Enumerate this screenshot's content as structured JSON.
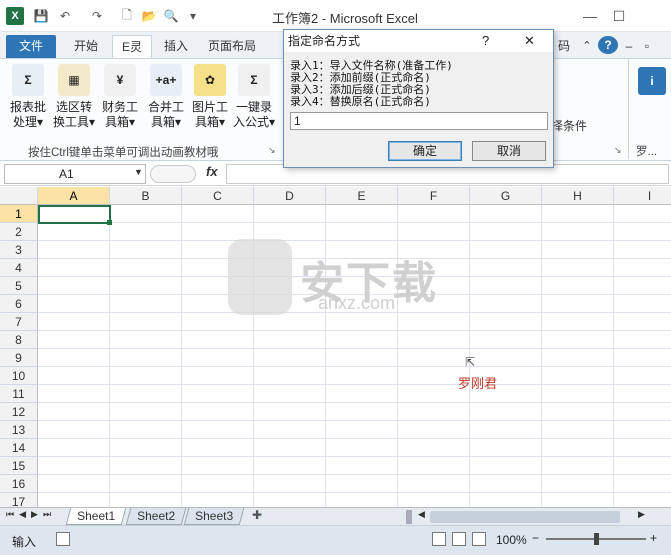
{
  "window": {
    "title": "工作簿2 - Microsoft Excel",
    "minimize": "—",
    "restore": "☐"
  },
  "tabs": {
    "file": "文件",
    "home": "开始",
    "eling": "E灵",
    "insert": "插入",
    "page_layout": "页面布局",
    "partial_tab": "码"
  },
  "ribbon": {
    "buttons": [
      {
        "line1": "报表批",
        "line2": "处理▾",
        "icon_name": "report-batch-icon",
        "glyph": "Σ"
      },
      {
        "line1": "选区转",
        "line2": "换工具▾",
        "icon_name": "range-convert-icon",
        "glyph": "▦"
      },
      {
        "line1": "财务工",
        "line2": "具箱▾",
        "icon_name": "finance-tools-icon",
        "glyph": "¥"
      },
      {
        "line1": "合并工",
        "line2": "具箱▾",
        "icon_name": "merge-tools-icon",
        "glyph": "+a+"
      },
      {
        "line1": "图片工",
        "line2": "具箱▾",
        "icon_name": "picture-tools-icon",
        "glyph": "✿"
      },
      {
        "line1": "一键录",
        "line2": "入公式▾",
        "icon_name": "formula-entry-icon",
        "glyph": "Σ"
      }
    ],
    "group_caption": "按住Ctrl键单击菜单可调出动画教材哦",
    "right_partial": "择条件",
    "right_partial2": "罗..."
  },
  "formula_bar": {
    "name_box": "A1",
    "fx": "fx",
    "value": ""
  },
  "grid": {
    "columns": [
      "A",
      "B",
      "C",
      "D",
      "E",
      "F",
      "G",
      "H",
      "I"
    ],
    "rows": [
      "1",
      "2",
      "3",
      "4",
      "5",
      "6",
      "7",
      "8",
      "9",
      "10",
      "11",
      "12",
      "13",
      "14",
      "15",
      "16",
      "17"
    ],
    "cell_text": "罗刚君"
  },
  "sheets": {
    "tabs": [
      "Sheet1",
      "Sheet2",
      "Sheet3"
    ],
    "active": "Sheet1"
  },
  "status": {
    "mode": "输入",
    "zoom": "100%"
  },
  "dialog": {
    "title": "指定命名方式",
    "help": "?",
    "close": "✕",
    "lines": [
      "录入1：导入文件名称(准备工作)",
      "录入2：添加前缀(正式命名)",
      "录入3：添加后缀(正式命名)",
      "录入4：替换原名(正式命名)"
    ],
    "input_value": "1",
    "ok": "确定",
    "cancel": "取消"
  },
  "colors": {
    "file_tab": "#2e75b6",
    "cell_text": "#c0392b",
    "selection": "#217346"
  }
}
